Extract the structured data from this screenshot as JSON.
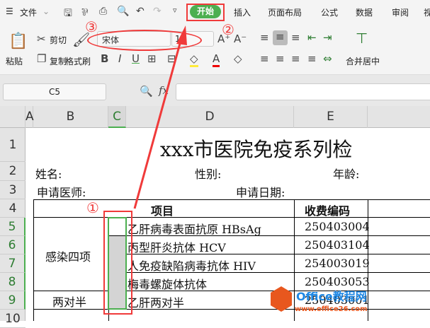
{
  "menu": {
    "file": "文件",
    "tabs": [
      "开始",
      "插入",
      "页面布局",
      "公式",
      "数据",
      "审阅",
      "视"
    ]
  },
  "ribbon": {
    "paste": "粘贴",
    "cut": "剪切",
    "copy": "复制",
    "format_painter": "格式刷",
    "font_name": "宋体",
    "font_size": "1",
    "merge_center": "合并居中"
  },
  "formula_bar": {
    "name_box": "C5",
    "fx": "fx",
    "formula": ""
  },
  "columns": [
    "A",
    "B",
    "C",
    "D",
    "E"
  ],
  "rows": [
    "1",
    "2",
    "3",
    "4",
    "5",
    "6",
    "7",
    "8",
    "9",
    "10"
  ],
  "sheet": {
    "title": "xxx市医院免疫系列检",
    "name_label": "姓名:",
    "gender_label": "性别:",
    "age_label": "年龄:",
    "doctor_label": "申请医师:",
    "date_label": "申请日期:",
    "header_item": "项目",
    "header_code": "收费编码",
    "group1": "感染四项",
    "group2": "两对半",
    "items": [
      {
        "name": "乙肝病毒表面抗原 HBsAg",
        "code": "250403004"
      },
      {
        "name": "丙型肝炎抗体 HCV",
        "code": "250403104"
      },
      {
        "name": "人免疫缺陷病毒抗体 HIV",
        "code": "254003019"
      },
      {
        "name": "梅毒螺旋体抗体",
        "code": "250403053"
      },
      {
        "name": "乙肝两对半",
        "code": "250403001"
      }
    ]
  },
  "annotations": {
    "one": "①",
    "two": "②",
    "three": "③"
  },
  "watermark": {
    "brand": "Office教程网",
    "url": "www.office26.com"
  }
}
